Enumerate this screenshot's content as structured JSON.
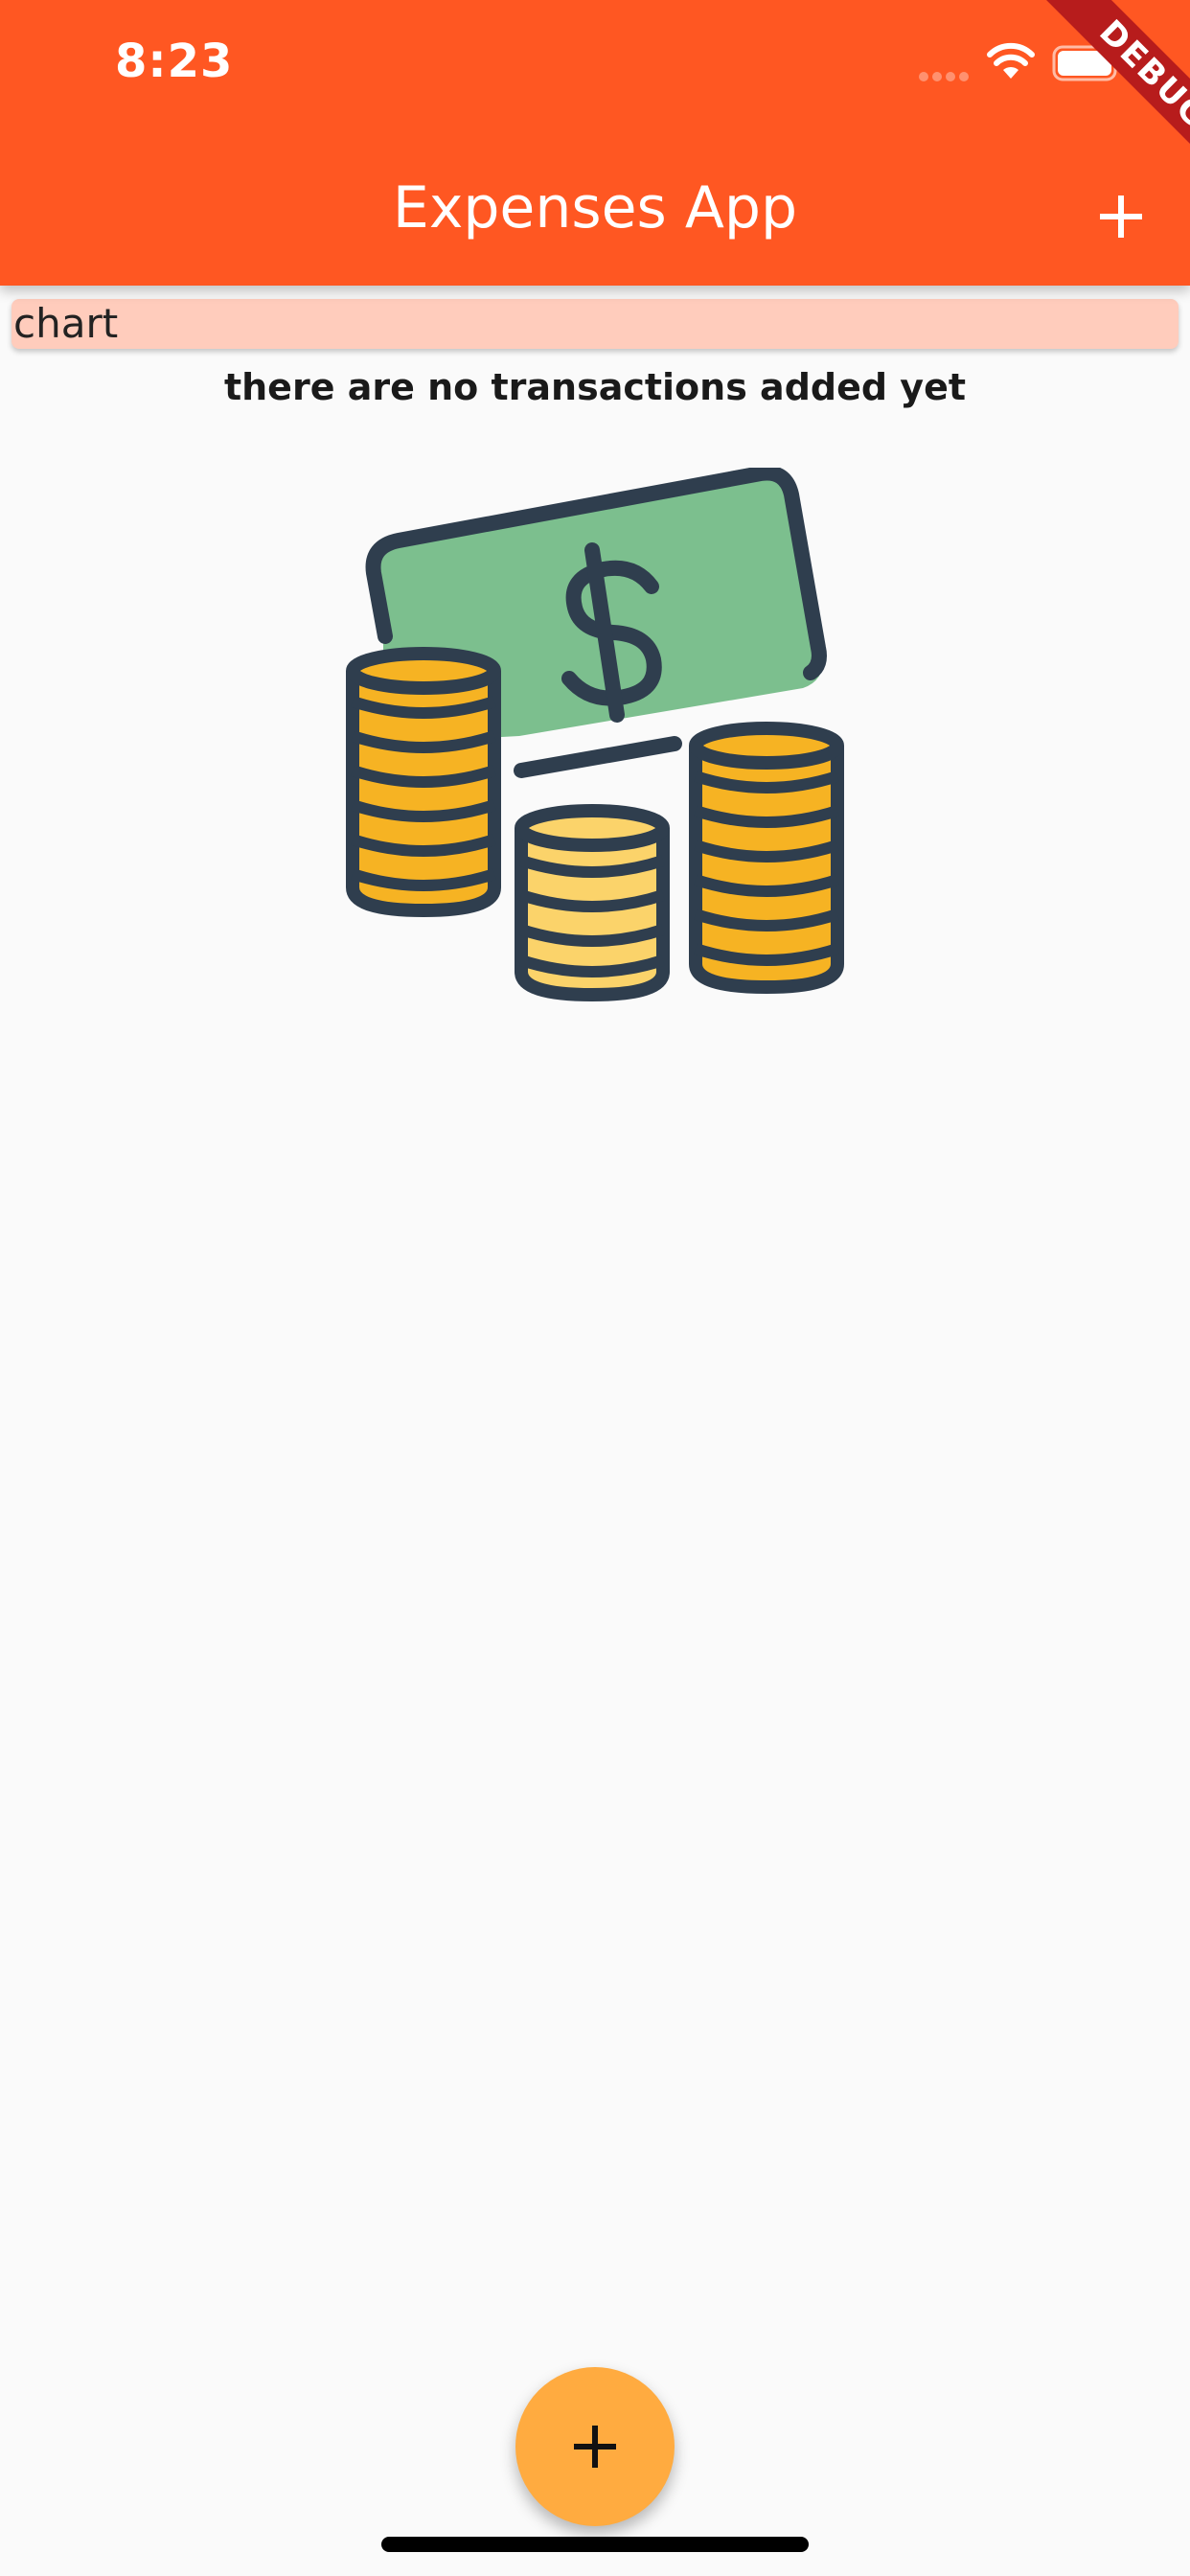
{
  "status_bar": {
    "time": "8:23"
  },
  "app_bar": {
    "title": "Expenses App",
    "add_icon": "plus-icon",
    "background_color": "#ff5722"
  },
  "debug_banner": {
    "text": "DEBUG"
  },
  "chart": {
    "label": "chart",
    "background_color": "#ffccbc"
  },
  "empty_state": {
    "message": "there are no transactions added yet",
    "illustration": "money-coins-illustration"
  },
  "fab": {
    "icon": "plus-icon",
    "background_color": "#ffab40"
  }
}
